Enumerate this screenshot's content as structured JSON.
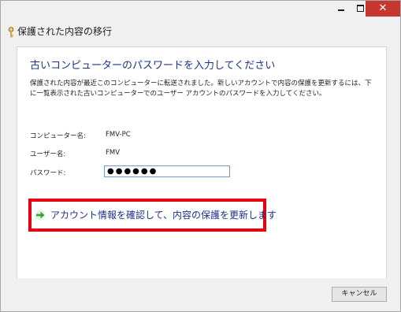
{
  "window": {
    "controls": {
      "minimize": "",
      "maximize": "",
      "close": "✕"
    },
    "title": "保護された内容の移行",
    "icon": "key-icon"
  },
  "main": {
    "heading": "古いコンピューターのパスワードを入力してください",
    "description": "保護された内容が最近このコンピューターに転送されました。新しいアカウントで内容の保護を更新するには、下に一覧表示された古いコンピューターでのユーザー アカウントのパスワードを入力してください。",
    "fields": [
      {
        "label": "コンピューター名:",
        "value": "FMV-PC"
      },
      {
        "label": "ユーザー名:",
        "value": "FMV"
      },
      {
        "label": "パスワード:",
        "value": "●●●●●●"
      }
    ],
    "action": {
      "icon": "green-arrow-icon",
      "label": "アカウント情報を確認して、内容の保護を更新します"
    }
  },
  "footer": {
    "cancel_label": "キャンセル"
  },
  "colors": {
    "heading": "#1e3287",
    "highlight_border": "#e60012",
    "close_button": "#c7372f",
    "arrow": "#3aa63a"
  }
}
